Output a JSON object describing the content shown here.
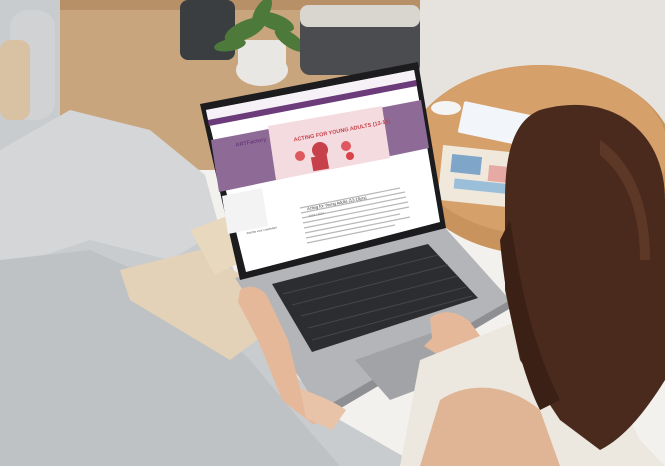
{
  "screen": {
    "site_name": "ARTFactory",
    "banner_title": "ACTING FOR YOUNG ADULTS (13-18)",
    "side_label": "Ruimte voor creativiteit",
    "course_title": "Acting for Young Adults (13-18yrs)",
    "course_subtitle": "2023 / 2024"
  },
  "colors": {
    "wall": "#e4e1dc",
    "sofa": "#cfd1d3",
    "laptop": "#a7a8ac",
    "keyboard": "#2c2d31",
    "screen_purple": "#8e6b97",
    "banner_pink": "#f4dbe0",
    "hair": "#4a2a1c",
    "table_wood": "#c9935e"
  }
}
